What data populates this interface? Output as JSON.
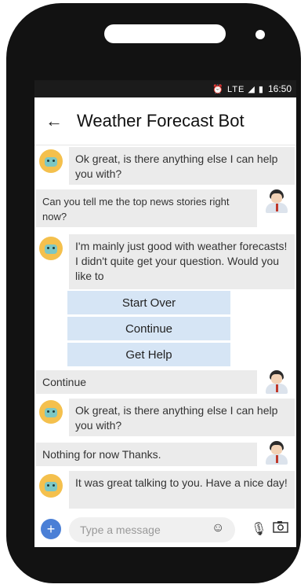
{
  "status": {
    "icons": "⏰ LTE ◢ ▮",
    "time": "16:50"
  },
  "header": {
    "back_icon": "back-arrow-icon",
    "title": "Weather Forecast Bot"
  },
  "messages": [
    {
      "from": "bot",
      "text": "Ok great, is there anything  else I can help you with?"
    },
    {
      "from": "user",
      "text": "Can you tell me the top news stories right now?"
    },
    {
      "from": "bot",
      "text": "I'm mainly just good with weather forecasts! I didn't quite get your question. Would you like to"
    },
    {
      "from": "user",
      "text": "Continue"
    },
    {
      "from": "bot",
      "text": "Ok great, is there anything  else I can help you with?"
    },
    {
      "from": "user",
      "text": "Nothing for now Thanks."
    },
    {
      "from": "bot",
      "text": "It was great talking to you. Have a nice day!"
    }
  ],
  "options": [
    "Start Over",
    "Continue",
    "Get Help"
  ],
  "composer": {
    "placeholder": "Type a message",
    "icons": [
      "add-icon",
      "emoji-icon",
      "microphone-icon",
      "camera-icon"
    ]
  },
  "colors": {
    "bubble": "#ebebeb",
    "option": "#d6e5f5",
    "accent": "#4a7fd6"
  }
}
